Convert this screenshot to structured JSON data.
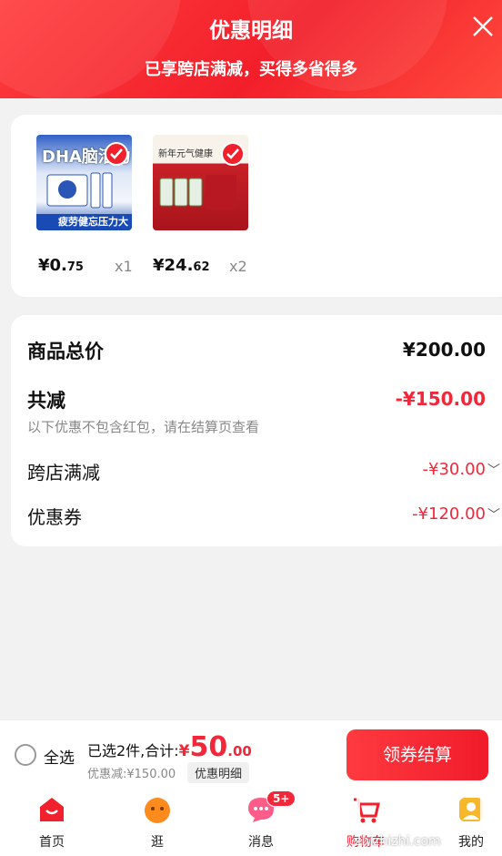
{
  "header": {
    "title": "优惠明细",
    "subtitle": "已享跨店满减，买得多省得多",
    "close_icon": "close-icon"
  },
  "products": [
    {
      "image_text": "DHA脑活力",
      "image_caption": "疲劳健忘压力大",
      "price_int": "¥0.",
      "price_dec": "75",
      "qty": "x1"
    },
    {
      "image_text": "新年元气健康",
      "price_int": "¥24.",
      "price_dec": "62",
      "qty": "x2"
    }
  ],
  "summary": {
    "total_label": "商品总价",
    "total_value": "¥200.00",
    "reduce_label": "共减",
    "reduce_value": "-¥150.00",
    "note": "以下优惠不包含红包，请在结算页查看",
    "cross_store_label": "跨店满减",
    "cross_store_value": "-¥30.00",
    "coupon_label": "优惠券",
    "coupon_value": "-¥120.00"
  },
  "bottom_bar": {
    "select_all": "全选",
    "selected_text": "已选2件,合计:",
    "currency": "¥",
    "amount_int": "50",
    "amount_dec": ".00",
    "discount_text": "优惠减:¥150.00",
    "detail_chip": "优惠明细",
    "checkout_label": "领券结算"
  },
  "tabbar": {
    "tabs": [
      {
        "label": "首页",
        "icon": "home-icon"
      },
      {
        "label": "逛",
        "icon": "stroll-icon"
      },
      {
        "label": "消息",
        "icon": "message-icon",
        "badge": "5+"
      },
      {
        "label": "购物车",
        "icon": "cart-icon"
      },
      {
        "label": "我的",
        "icon": "profile-icon"
      }
    ]
  },
  "watermark": "zhizhizhi.com",
  "colors": {
    "accent": "#f2273a",
    "header_red": "#f21f2a",
    "muted": "#888888"
  }
}
